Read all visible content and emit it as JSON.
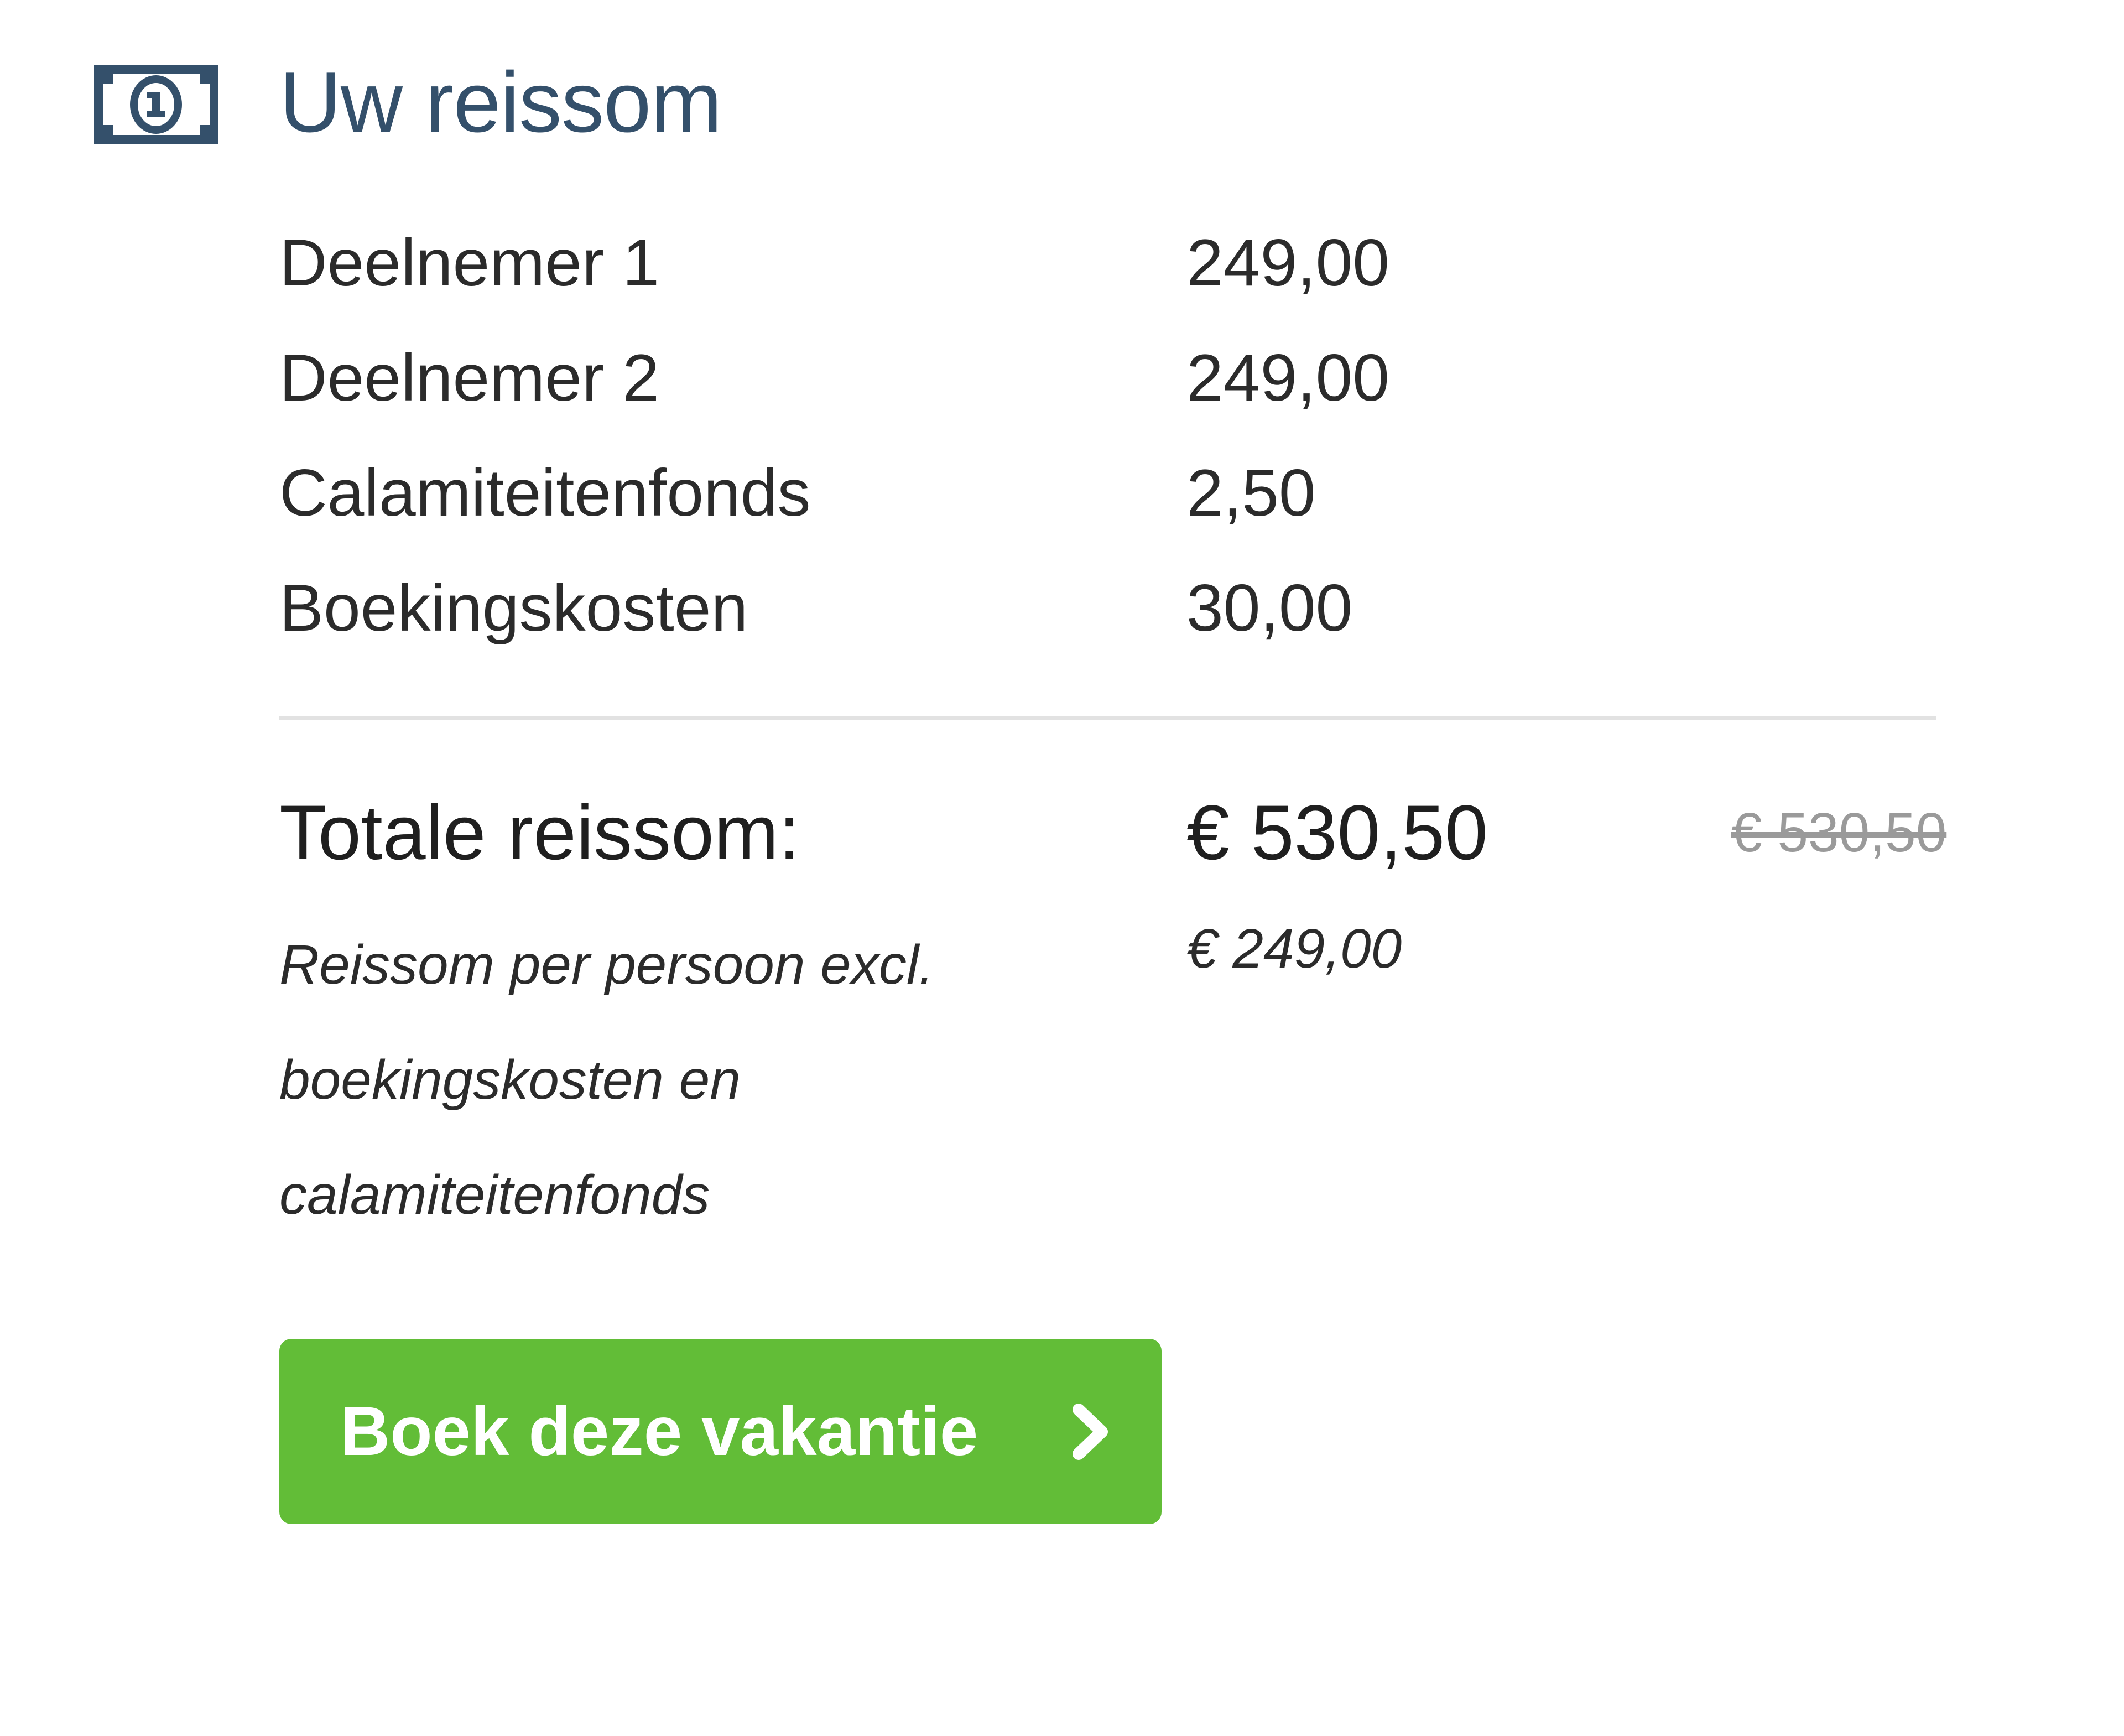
{
  "header": {
    "icon": "money-bill-icon",
    "title": "Uw reissom"
  },
  "lines": [
    {
      "label": "Deelnemer 1",
      "amount": "249,00"
    },
    {
      "label": "Deelnemer 2",
      "amount": "249,00"
    },
    {
      "label": "Calamiteitenfonds",
      "amount": "2,50"
    },
    {
      "label": "Boekingskosten",
      "amount": "30,00"
    }
  ],
  "total": {
    "label": "Totale reissom:",
    "amount": "€ 530,50",
    "old_amount": "€ 530,50"
  },
  "per_person": {
    "text": "Reissom per persoon excl. boekingskosten en calamiteitenfonds",
    "amount": "€ 249,00"
  },
  "cta": {
    "label": "Boek deze vakantie",
    "icon": "chevron-right-icon",
    "color": "#62bd37"
  },
  "colors": {
    "title": "#34506b",
    "text": "#2b2b2b",
    "muted": "#9a9a9a"
  }
}
